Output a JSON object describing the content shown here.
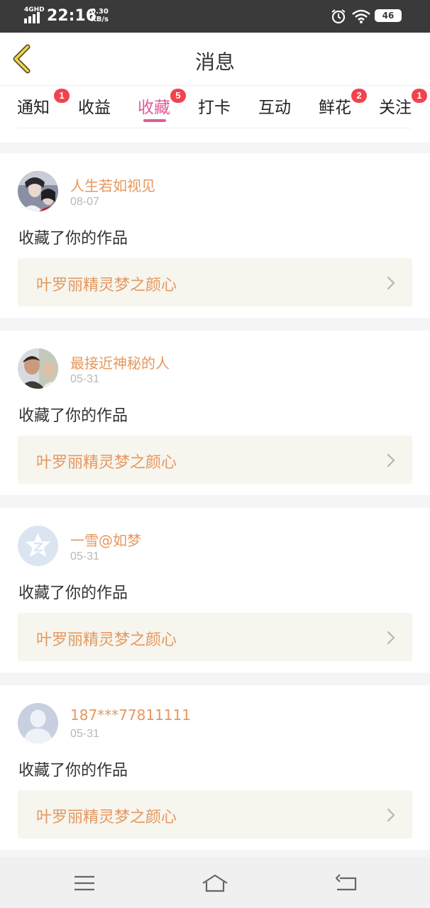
{
  "status_bar": {
    "network": "4GHD",
    "time": "22:16",
    "speed_value": "0.30",
    "speed_unit": "KB/s",
    "battery": "46"
  },
  "header": {
    "title": "消息"
  },
  "tabs": [
    {
      "label": "通知",
      "badge": "1"
    },
    {
      "label": "收益",
      "badge": ""
    },
    {
      "label": "收藏",
      "badge": "5",
      "active": true
    },
    {
      "label": "打卡",
      "badge": ""
    },
    {
      "label": "互动",
      "badge": ""
    },
    {
      "label": "鲜花",
      "badge": "2"
    },
    {
      "label": "关注",
      "badge": "1"
    }
  ],
  "messages": [
    {
      "user": "人生若如视见",
      "date": "08-07",
      "action": "收藏了你的作品",
      "work": "叶罗丽精灵梦之颜心",
      "avatar": "photo-avatar"
    },
    {
      "user": "最接近神秘的人",
      "date": "05-31",
      "action": "收藏了你的作品",
      "work": "叶罗丽精灵梦之颜心",
      "avatar": "photo-avatar"
    },
    {
      "user": "一雪@如梦",
      "date": "05-31",
      "action": "收藏了你的作品",
      "work": "叶罗丽精灵梦之颜心",
      "avatar": "qzone-avatar"
    },
    {
      "user": "187***77811111",
      "date": "05-31",
      "action": "收藏了你的作品",
      "work": "叶罗丽精灵梦之颜心",
      "avatar": "default-avatar"
    }
  ],
  "colors": {
    "accent": "#e05b9a",
    "name": "#e6975f",
    "badge": "#f1434d"
  }
}
